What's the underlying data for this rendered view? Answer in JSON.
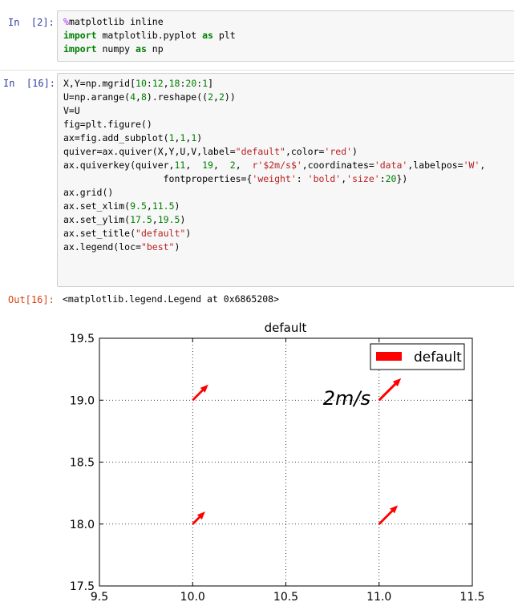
{
  "cells": [
    {
      "prompt": "In  [2]:",
      "lines": [
        [
          [
            "mg",
            "%"
          ],
          [
            "",
            "matplotlib inline"
          ]
        ],
        [
          [
            "kw",
            "import"
          ],
          [
            "",
            " matplotlib.pyplot "
          ],
          [
            "kw",
            "as"
          ],
          [
            "",
            " plt"
          ]
        ],
        [
          [
            "kw",
            "import"
          ],
          [
            "",
            " numpy "
          ],
          [
            "kw",
            "as"
          ],
          [
            "",
            " np"
          ]
        ]
      ]
    },
    {
      "prompt": "In  [16]:",
      "lines": [
        [
          [
            "",
            "X,Y=np.mgrid["
          ],
          [
            "num",
            "10"
          ],
          [
            "",
            ":"
          ],
          [
            "num",
            "12"
          ],
          [
            "",
            ","
          ],
          [
            "num",
            "18"
          ],
          [
            "",
            ":"
          ],
          [
            "num",
            "20"
          ],
          [
            "",
            ":"
          ],
          [
            "num",
            "1"
          ],
          [
            "",
            "]"
          ]
        ],
        [
          [
            "",
            "U=np.arange("
          ],
          [
            "num",
            "4"
          ],
          [
            "",
            ","
          ],
          [
            "num",
            "8"
          ],
          [
            "",
            ").reshape(("
          ],
          [
            "num",
            "2"
          ],
          [
            "",
            ","
          ],
          [
            "num",
            "2"
          ],
          [
            "",
            "))"
          ]
        ],
        [
          [
            "",
            "V=U"
          ]
        ],
        [
          [
            "",
            "fig=plt.figure()"
          ]
        ],
        [
          [
            "",
            "ax=fig.add_subplot("
          ],
          [
            "num",
            "1"
          ],
          [
            "",
            ","
          ],
          [
            "num",
            "1"
          ],
          [
            "",
            ","
          ],
          [
            "num",
            "1"
          ],
          [
            "",
            ")"
          ]
        ],
        [
          [
            "",
            "quiver=ax.quiver(X,Y,U,V,label="
          ],
          [
            "str",
            "\"default\""
          ],
          [
            "",
            ",color="
          ],
          [
            "str",
            "'red'"
          ],
          [
            "",
            ")"
          ]
        ],
        [
          [
            "",
            "ax.quiverkey(quiver,"
          ],
          [
            "num",
            "11"
          ],
          [
            "",
            ",  "
          ],
          [
            "num",
            "19"
          ],
          [
            "",
            ",  "
          ],
          [
            "num",
            "2"
          ],
          [
            "",
            ",  "
          ],
          [
            "str",
            "r'$2m/s$'"
          ],
          [
            "",
            ",coordinates="
          ],
          [
            "str",
            "'data'"
          ],
          [
            "",
            ",labelpos="
          ],
          [
            "str",
            "'W'"
          ],
          [
            "",
            ","
          ]
        ],
        [
          [
            "",
            "                  fontproperties={"
          ],
          [
            "str",
            "'weight'"
          ],
          [
            "",
            ": "
          ],
          [
            "str",
            "'bold'"
          ],
          [
            "",
            ","
          ],
          [
            "str",
            "'size'"
          ],
          [
            "",
            ":"
          ],
          [
            "num",
            "20"
          ],
          [
            "",
            "})"
          ]
        ],
        [
          [
            "",
            "ax.grid()"
          ]
        ],
        [
          [
            "",
            "ax.set_xlim("
          ],
          [
            "num",
            "9.5"
          ],
          [
            "",
            ","
          ],
          [
            "num",
            "11.5"
          ],
          [
            "",
            ")"
          ]
        ],
        [
          [
            "",
            "ax.set_ylim("
          ],
          [
            "num",
            "17.5"
          ],
          [
            "",
            ","
          ],
          [
            "num",
            "19.5"
          ],
          [
            "",
            ")"
          ]
        ],
        [
          [
            "",
            "ax.set_title("
          ],
          [
            "str",
            "\"default\""
          ],
          [
            "",
            ")"
          ]
        ],
        [
          [
            "",
            "ax.legend(loc="
          ],
          [
            "str",
            "\"best\""
          ],
          [
            "",
            ")"
          ]
        ]
      ]
    }
  ],
  "output": {
    "prompt": "Out[16]:",
    "text": "<matplotlib.legend.Legend at 0x6865208>"
  },
  "chart_data": {
    "type": "quiver",
    "title": "default",
    "xlim": [
      9.5,
      11.5
    ],
    "ylim": [
      17.5,
      19.5
    ],
    "xticks": [
      "9.5",
      "10.0",
      "10.5",
      "11.0",
      "11.5"
    ],
    "yticks": [
      "17.5",
      "18.0",
      "18.5",
      "19.0",
      "19.5"
    ],
    "grid": true,
    "legend": {
      "label": "default",
      "placement": "top-right"
    },
    "quiverkey": {
      "label": "2m/s",
      "x": 11,
      "y": 19,
      "U": 2
    },
    "arrow_color": "#ff0000",
    "vectors": [
      {
        "x": 10,
        "y": 18,
        "u": 4,
        "v": 4
      },
      {
        "x": 10,
        "y": 19,
        "u": 5,
        "v": 5
      },
      {
        "x": 11,
        "y": 18,
        "u": 6,
        "v": 6
      },
      {
        "x": 11,
        "y": 19,
        "u": 7,
        "v": 7
      }
    ]
  }
}
